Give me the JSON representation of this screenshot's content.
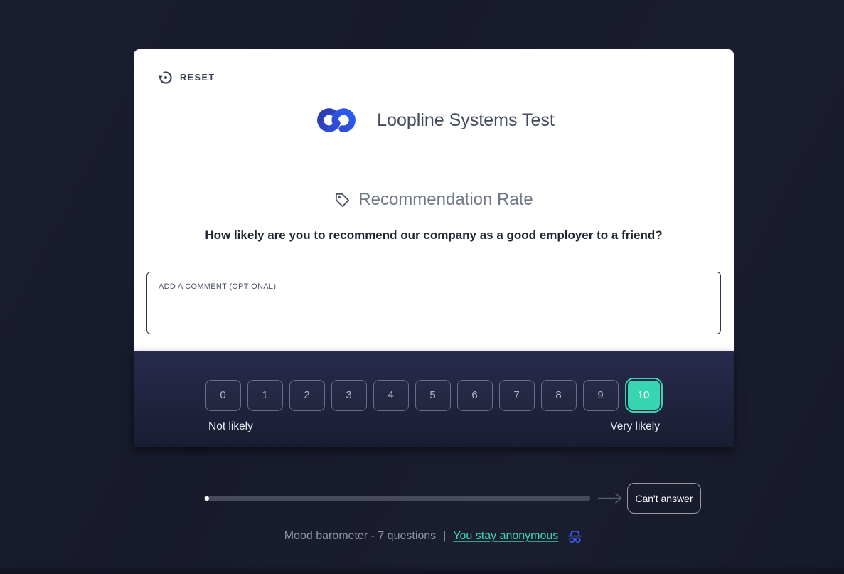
{
  "colors": {
    "accent_teal": "#38d5b2",
    "brand_blue_dark": "#2c3aae",
    "brand_blue_bright": "#2b5cf5",
    "anon_icon_blue": "#3d5be0",
    "page_bg": "#181b2d",
    "panel_top": "#272b4c"
  },
  "card": {
    "reset_label": "RESET",
    "brand_title": "Loopline Systems Test",
    "question_category": "Recommendation Rate",
    "question_text": "How likely are you to recommend our company as a good employer to a friend?",
    "comment_placeholder": "ADD A COMMENT (OPTIONAL)",
    "comment_value": ""
  },
  "rating": {
    "options": [
      "0",
      "1",
      "2",
      "3",
      "4",
      "5",
      "6",
      "7",
      "8",
      "9",
      "10"
    ],
    "selected": "10",
    "min_label": "Not likely",
    "max_label": "Very likely"
  },
  "nav": {
    "cant_answer_label": "Can't answer"
  },
  "footer": {
    "survey_info": "Mood barometer - 7 questions",
    "separator": "|",
    "anonymous_label": "You stay anonymous"
  }
}
